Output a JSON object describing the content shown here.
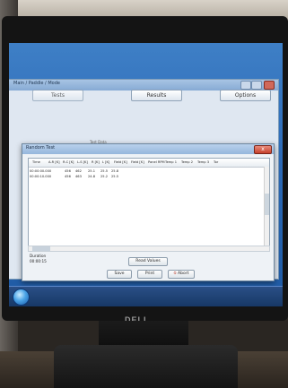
{
  "app": {
    "window_title": "Main / Paddle / Mode",
    "tabs": [
      {
        "label": "Tests"
      },
      {
        "label": "Results"
      },
      {
        "label": "Options"
      }
    ]
  },
  "dialog": {
    "title": "Random Test",
    "close_glyph": "x",
    "group_label": "Test Data",
    "columns": [
      "Time",
      "A-R [K]",
      "R-C [K]",
      "L-S [K]",
      "R [K]",
      "L [K]",
      "Field [K]",
      "Field [K]",
      "Panel RPM",
      "Temp 1",
      "Temp 2",
      "Temp 3",
      "Tor"
    ],
    "rows": [
      [
        "00:00:00.000",
        "456",
        "462",
        "25.1",
        "25.5",
        "25.8"
      ],
      [
        "00:00:10.000",
        "456",
        "463",
        "24.8",
        "25.2",
        "25.5"
      ]
    ],
    "duration_label": "Duration",
    "duration_value": "00:00:15",
    "read_button": "Read Values",
    "buttons": {
      "save": "Save",
      "print": "Print",
      "abort": "Abort"
    }
  },
  "monitor": {
    "brand": "DELL"
  },
  "colors": {
    "desktop": "#2d6ab6",
    "close_button": "#c6402c"
  }
}
